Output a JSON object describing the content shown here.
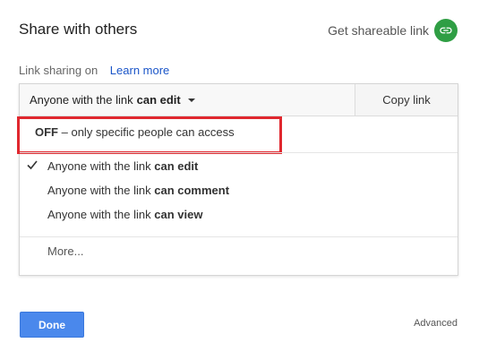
{
  "dialog": {
    "title": "Share with others",
    "get_shareable_link": "Get shareable link"
  },
  "link_sharing": {
    "status": "Link sharing on",
    "learn_more": "Learn more"
  },
  "dropdown": {
    "current_prefix": "Anyone with the link",
    "current_emphasis": "can edit",
    "copy_link": "Copy link"
  },
  "menu": {
    "off_label": "OFF",
    "off_desc": "– only specific people can access",
    "items": [
      {
        "prefix": "Anyone with the link",
        "emphasis": "can edit",
        "checked": true
      },
      {
        "prefix": "Anyone with the link",
        "emphasis": "can comment",
        "checked": false
      },
      {
        "prefix": "Anyone with the link",
        "emphasis": "can view",
        "checked": false
      }
    ],
    "more": "More..."
  },
  "footer": {
    "done": "Done",
    "advanced": "Advanced"
  },
  "colors": {
    "link_icon_bg": "#2f9e44",
    "highlight_border": "#e0282f",
    "done_bg": "#4a88ec",
    "learn_more": "#1a55c8"
  },
  "icons": [
    "link-icon",
    "caret-down-icon",
    "checkmark-icon"
  ]
}
